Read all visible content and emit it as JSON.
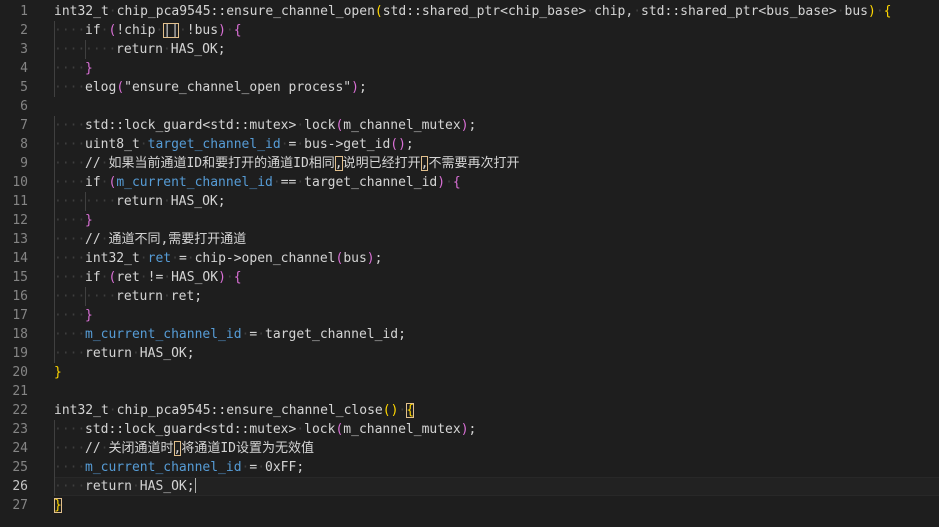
{
  "editor": {
    "active_line": 26,
    "lines": [
      {
        "n": "1",
        "indent": 0,
        "tokens": [
          {
            "t": "int32_t",
            "c": "t-plain"
          },
          {
            "t": " ",
            "c": "dots"
          },
          {
            "t": "chip_pca9545::ensure_channel_open",
            "c": "t-plain"
          },
          {
            "t": "(",
            "c": "t-b1"
          },
          {
            "t": "std::shared_ptr<chip_base>",
            "c": "t-plain"
          },
          {
            "t": " ",
            "c": "dots"
          },
          {
            "t": "chip,",
            "c": "t-plain"
          },
          {
            "t": " ",
            "c": "dots"
          },
          {
            "t": "std::shared_ptr<bus_base>",
            "c": "t-plain"
          },
          {
            "t": " ",
            "c": "dots"
          },
          {
            "t": "bus",
            "c": "t-plain"
          },
          {
            "t": ")",
            "c": "t-b1"
          },
          {
            "t": " ",
            "c": "dots"
          },
          {
            "t": "{",
            "c": "t-b1"
          }
        ]
      },
      {
        "n": "2",
        "indent": 1,
        "tokens": [
          {
            "t": "if",
            "c": "t-plain"
          },
          {
            "t": " ",
            "c": "dots"
          },
          {
            "t": "(",
            "c": "t-b2"
          },
          {
            "t": "!chip",
            "c": "t-plain"
          },
          {
            "t": " ",
            "c": "dots"
          },
          {
            "t": "||",
            "c": "t-plain",
            "box": true
          },
          {
            "t": " ",
            "c": "dots"
          },
          {
            "t": "!bus",
            "c": "t-plain"
          },
          {
            "t": ")",
            "c": "t-b2"
          },
          {
            "t": " ",
            "c": "dots"
          },
          {
            "t": "{",
            "c": "t-b2"
          }
        ]
      },
      {
        "n": "3",
        "indent": 2,
        "tokens": [
          {
            "t": "return",
            "c": "t-plain"
          },
          {
            "t": " ",
            "c": "dots"
          },
          {
            "t": "HAS_OK;",
            "c": "t-plain"
          }
        ]
      },
      {
        "n": "4",
        "indent": 1,
        "tokens": [
          {
            "t": "}",
            "c": "t-b2"
          }
        ]
      },
      {
        "n": "5",
        "indent": 1,
        "tokens": [
          {
            "t": "elog",
            "c": "t-plain"
          },
          {
            "t": "(",
            "c": "t-b2"
          },
          {
            "t": "\"ensure_channel_open process\"",
            "c": "t-plain"
          },
          {
            "t": ")",
            "c": "t-b2"
          },
          {
            "t": ";",
            "c": "t-plain"
          }
        ]
      },
      {
        "n": "6",
        "indent": 0,
        "tokens": []
      },
      {
        "n": "7",
        "indent": 1,
        "tokens": [
          {
            "t": "std::lock_guard<std::mutex>",
            "c": "t-plain"
          },
          {
            "t": " ",
            "c": "dots"
          },
          {
            "t": "lock",
            "c": "t-plain"
          },
          {
            "t": "(",
            "c": "t-b2"
          },
          {
            "t": "m_channel_mutex",
            "c": "t-plain"
          },
          {
            "t": ")",
            "c": "t-b2"
          },
          {
            "t": ";",
            "c": "t-plain"
          }
        ]
      },
      {
        "n": "8",
        "indent": 1,
        "tokens": [
          {
            "t": "uint8_t",
            "c": "t-plain"
          },
          {
            "t": " ",
            "c": "dots"
          },
          {
            "t": "target_channel_id",
            "c": "t-field"
          },
          {
            "t": " ",
            "c": "dots"
          },
          {
            "t": "=",
            "c": "t-plain"
          },
          {
            "t": " ",
            "c": "dots"
          },
          {
            "t": "bus->get_id",
            "c": "t-plain"
          },
          {
            "t": "(",
            "c": "t-b2"
          },
          {
            "t": ")",
            "c": "t-b2"
          },
          {
            "t": ";",
            "c": "t-plain"
          }
        ]
      },
      {
        "n": "9",
        "indent": 1,
        "tokens": [
          {
            "t": "//",
            "c": "t-plain"
          },
          {
            "t": " ",
            "c": "dots"
          },
          {
            "t": "如果当前通道ID和要打开的通道ID相同",
            "c": "t-plain"
          },
          {
            "t": ",",
            "c": "t-plain",
            "box": true
          },
          {
            "t": "说明已经打开",
            "c": "t-plain"
          },
          {
            "t": ",",
            "c": "t-plain",
            "box": true
          },
          {
            "t": "不需要再次打开",
            "c": "t-plain"
          }
        ]
      },
      {
        "n": "10",
        "indent": 1,
        "tokens": [
          {
            "t": "if",
            "c": "t-plain"
          },
          {
            "t": " ",
            "c": "dots"
          },
          {
            "t": "(",
            "c": "t-b2"
          },
          {
            "t": "m_current_channel_id",
            "c": "t-field"
          },
          {
            "t": " ",
            "c": "dots"
          },
          {
            "t": "==",
            "c": "t-plain"
          },
          {
            "t": " ",
            "c": "dots"
          },
          {
            "t": "target_channel_id",
            "c": "t-plain"
          },
          {
            "t": ")",
            "c": "t-b2"
          },
          {
            "t": " ",
            "c": "dots"
          },
          {
            "t": "{",
            "c": "t-b2"
          }
        ]
      },
      {
        "n": "11",
        "indent": 2,
        "tokens": [
          {
            "t": "return",
            "c": "t-plain"
          },
          {
            "t": " ",
            "c": "dots"
          },
          {
            "t": "HAS_OK;",
            "c": "t-plain"
          }
        ]
      },
      {
        "n": "12",
        "indent": 1,
        "tokens": [
          {
            "t": "}",
            "c": "t-b2"
          }
        ]
      },
      {
        "n": "13",
        "indent": 1,
        "tokens": [
          {
            "t": "//",
            "c": "t-plain"
          },
          {
            "t": " ",
            "c": "dots"
          },
          {
            "t": "通道不同,需要打开通道",
            "c": "t-plain"
          }
        ]
      },
      {
        "n": "14",
        "indent": 1,
        "tokens": [
          {
            "t": "int32_t",
            "c": "t-plain"
          },
          {
            "t": " ",
            "c": "dots"
          },
          {
            "t": "ret",
            "c": "t-field"
          },
          {
            "t": " ",
            "c": "dots"
          },
          {
            "t": "=",
            "c": "t-plain"
          },
          {
            "t": " ",
            "c": "dots"
          },
          {
            "t": "chip->open_channel",
            "c": "t-plain"
          },
          {
            "t": "(",
            "c": "t-b2"
          },
          {
            "t": "bus",
            "c": "t-plain"
          },
          {
            "t": ")",
            "c": "t-b2"
          },
          {
            "t": ";",
            "c": "t-plain"
          }
        ]
      },
      {
        "n": "15",
        "indent": 1,
        "tokens": [
          {
            "t": "if",
            "c": "t-plain"
          },
          {
            "t": " ",
            "c": "dots"
          },
          {
            "t": "(",
            "c": "t-b2"
          },
          {
            "t": "ret",
            "c": "t-plain"
          },
          {
            "t": " ",
            "c": "dots"
          },
          {
            "t": "!=",
            "c": "t-plain"
          },
          {
            "t": " ",
            "c": "dots"
          },
          {
            "t": "HAS_OK",
            "c": "t-plain"
          },
          {
            "t": ")",
            "c": "t-b2"
          },
          {
            "t": " ",
            "c": "dots"
          },
          {
            "t": "{",
            "c": "t-b2"
          }
        ]
      },
      {
        "n": "16",
        "indent": 2,
        "tokens": [
          {
            "t": "return",
            "c": "t-plain"
          },
          {
            "t": " ",
            "c": "dots"
          },
          {
            "t": "ret;",
            "c": "t-plain"
          }
        ]
      },
      {
        "n": "17",
        "indent": 1,
        "tokens": [
          {
            "t": "}",
            "c": "t-b2"
          }
        ]
      },
      {
        "n": "18",
        "indent": 1,
        "tokens": [
          {
            "t": "m_current_channel_id",
            "c": "t-field"
          },
          {
            "t": " ",
            "c": "dots"
          },
          {
            "t": "=",
            "c": "t-plain"
          },
          {
            "t": " ",
            "c": "dots"
          },
          {
            "t": "target_channel_id;",
            "c": "t-plain"
          }
        ]
      },
      {
        "n": "19",
        "indent": 1,
        "tokens": [
          {
            "t": "return",
            "c": "t-plain"
          },
          {
            "t": " ",
            "c": "dots"
          },
          {
            "t": "HAS_OK;",
            "c": "t-plain"
          }
        ]
      },
      {
        "n": "20",
        "indent": 0,
        "tokens": [
          {
            "t": "}",
            "c": "t-b1"
          }
        ]
      },
      {
        "n": "21",
        "indent": 0,
        "tokens": []
      },
      {
        "n": "22",
        "indent": 0,
        "tokens": [
          {
            "t": "int32_t",
            "c": "t-plain"
          },
          {
            "t": " ",
            "c": "dots"
          },
          {
            "t": "chip_pca9545::ensure_channel_close",
            "c": "t-plain"
          },
          {
            "t": "(",
            "c": "t-b1"
          },
          {
            "t": ")",
            "c": "t-b1"
          },
          {
            "t": " ",
            "c": "dots"
          },
          {
            "t": "{",
            "c": "t-b1",
            "box": true
          }
        ]
      },
      {
        "n": "23",
        "indent": 1,
        "tokens": [
          {
            "t": "std::lock_guard<std::mutex>",
            "c": "t-plain"
          },
          {
            "t": " ",
            "c": "dots"
          },
          {
            "t": "lock",
            "c": "t-plain"
          },
          {
            "t": "(",
            "c": "t-b2"
          },
          {
            "t": "m_channel_mutex",
            "c": "t-plain"
          },
          {
            "t": ")",
            "c": "t-b2"
          },
          {
            "t": ";",
            "c": "t-plain"
          }
        ]
      },
      {
        "n": "24",
        "indent": 1,
        "tokens": [
          {
            "t": "//",
            "c": "t-plain"
          },
          {
            "t": " ",
            "c": "dots"
          },
          {
            "t": "关闭通道时",
            "c": "t-plain"
          },
          {
            "t": ",",
            "c": "t-plain",
            "box": true
          },
          {
            "t": "将通道ID设置为无效值",
            "c": "t-plain"
          }
        ]
      },
      {
        "n": "25",
        "indent": 1,
        "tokens": [
          {
            "t": "m_current_channel_id",
            "c": "t-field"
          },
          {
            "t": " ",
            "c": "dots"
          },
          {
            "t": "=",
            "c": "t-plain"
          },
          {
            "t": " ",
            "c": "dots"
          },
          {
            "t": "0xFF;",
            "c": "t-plain"
          }
        ]
      },
      {
        "n": "26",
        "indent": 1,
        "cursor": true,
        "tokens": [
          {
            "t": "return",
            "c": "t-plain"
          },
          {
            "t": " ",
            "c": "dots"
          },
          {
            "t": "HAS_OK;",
            "c": "t-plain"
          }
        ]
      },
      {
        "n": "27",
        "indent": 0,
        "tokens": [
          {
            "t": "}",
            "c": "t-b1",
            "box": true
          }
        ]
      }
    ]
  }
}
